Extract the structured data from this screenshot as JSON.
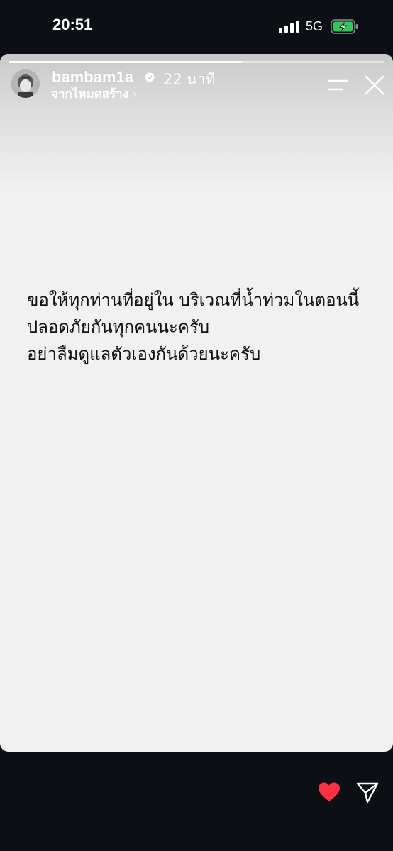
{
  "status_bar": {
    "time": "20:51",
    "network": "5G"
  },
  "story": {
    "progress": 0.62,
    "username": "bambam1a",
    "time_ago": "22 นาที",
    "source_label": "จากไหมดสร้าง",
    "text_lines": [
      "ขอให้ทุกท่านที่อยู่ใน บริเวณที่น้ำท่วมในตอนนี้",
      "ปลอดภัยกันทุกคนนะครับ",
      "อย่าลืมดูแลตัวเองกันด้วยนะครับ"
    ]
  },
  "icons": {
    "signal": "cellular-signal-icon",
    "battery": "battery-charging-icon",
    "verified": "verified-badge-icon",
    "menu": "menu-icon",
    "close": "close-icon",
    "like": "heart-icon",
    "share": "send-icon"
  },
  "colors": {
    "background": "#0c0f13",
    "story_background": "#f1f1f1",
    "battery_fill": "#34c759",
    "like": "#ff3040",
    "text": "#111111"
  }
}
